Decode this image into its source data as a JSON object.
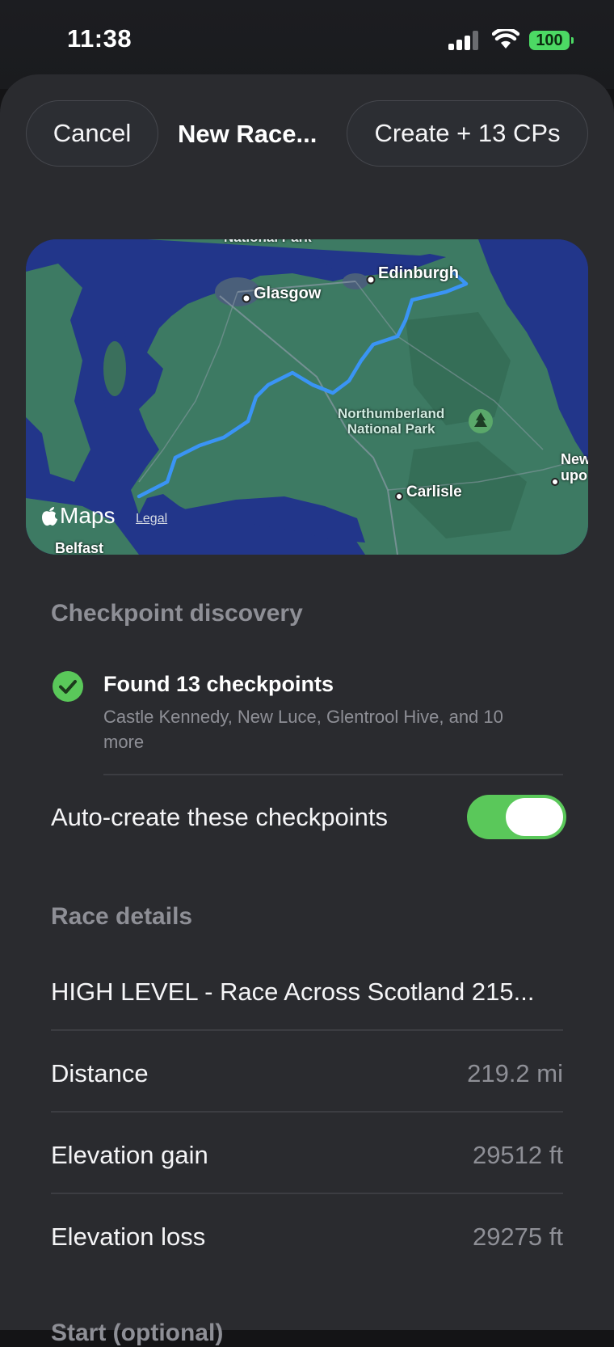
{
  "status_bar": {
    "time": "11:38",
    "battery": "100"
  },
  "nav": {
    "cancel_label": "Cancel",
    "title": "New Race...",
    "create_label": "Create + 13 CPs"
  },
  "map": {
    "labels": {
      "park_top": "National Park",
      "glasgow": "Glasgow",
      "edinburgh": "Edinburgh",
      "northumberland_line1": "Northumberland",
      "northumberland_line2": "National Park",
      "carlisle": "Carlisle",
      "newcastle_line1": "New",
      "newcastle_line2": "upo",
      "belfast": "Belfast"
    },
    "attribution": "Maps",
    "legal": "Legal",
    "colors": {
      "water": "#22368a",
      "land": "#3d7a63",
      "route": "#3a94f5"
    }
  },
  "checkpoint_discovery": {
    "header": "Checkpoint discovery",
    "found_title": "Found 13 checkpoints",
    "found_subtitle": "Castle Kennedy, New Luce, Glentrool Hive, and 10 more",
    "toggle_label": "Auto-create these checkpoints",
    "toggle_on": true
  },
  "race_details": {
    "header": "Race details",
    "race_name": "HIGH LEVEL - Race Across Scotland 215...",
    "rows": [
      {
        "label": "Distance",
        "value": "219.2 mi"
      },
      {
        "label": "Elevation gain",
        "value": "29512 ft"
      },
      {
        "label": "Elevation loss",
        "value": "29275 ft"
      }
    ],
    "next_header": "Start (optional)"
  }
}
